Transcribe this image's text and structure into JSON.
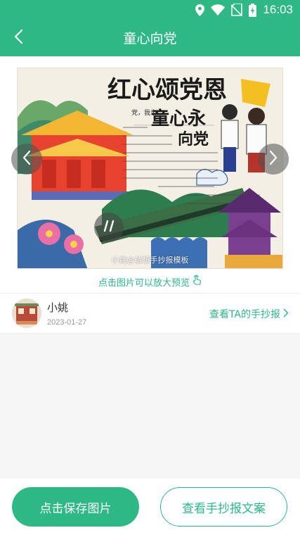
{
  "status_bar": {
    "time": "16:03",
    "icons": [
      "location-icon",
      "wifi-icon",
      "no-sim-icon",
      "battery-charging-icon"
    ]
  },
  "header": {
    "title": "童心向党",
    "back_icon": "chevron-left-icon"
  },
  "viewer": {
    "watermark": "小姚@信想手抄报模板",
    "zoom_hint": "点击图片可以放大预览",
    "prev_icon": "chevron-left-icon",
    "next_icon": "chevron-right-icon",
    "pause_icon": "pause-icon",
    "poster": {
      "headline": "红心颂党恩",
      "subhead_1": "童心永",
      "subhead_2": "向党",
      "intro": "党，我亲"
    }
  },
  "author": {
    "name": "小姚",
    "date": "2023-01-27",
    "view_link": "查看TA的手抄报"
  },
  "actions": {
    "save_label": "点击保存图片",
    "copy_label": "查看手抄报文案"
  },
  "colors": {
    "brand": "#2db884",
    "background": "#f5f5f5"
  }
}
